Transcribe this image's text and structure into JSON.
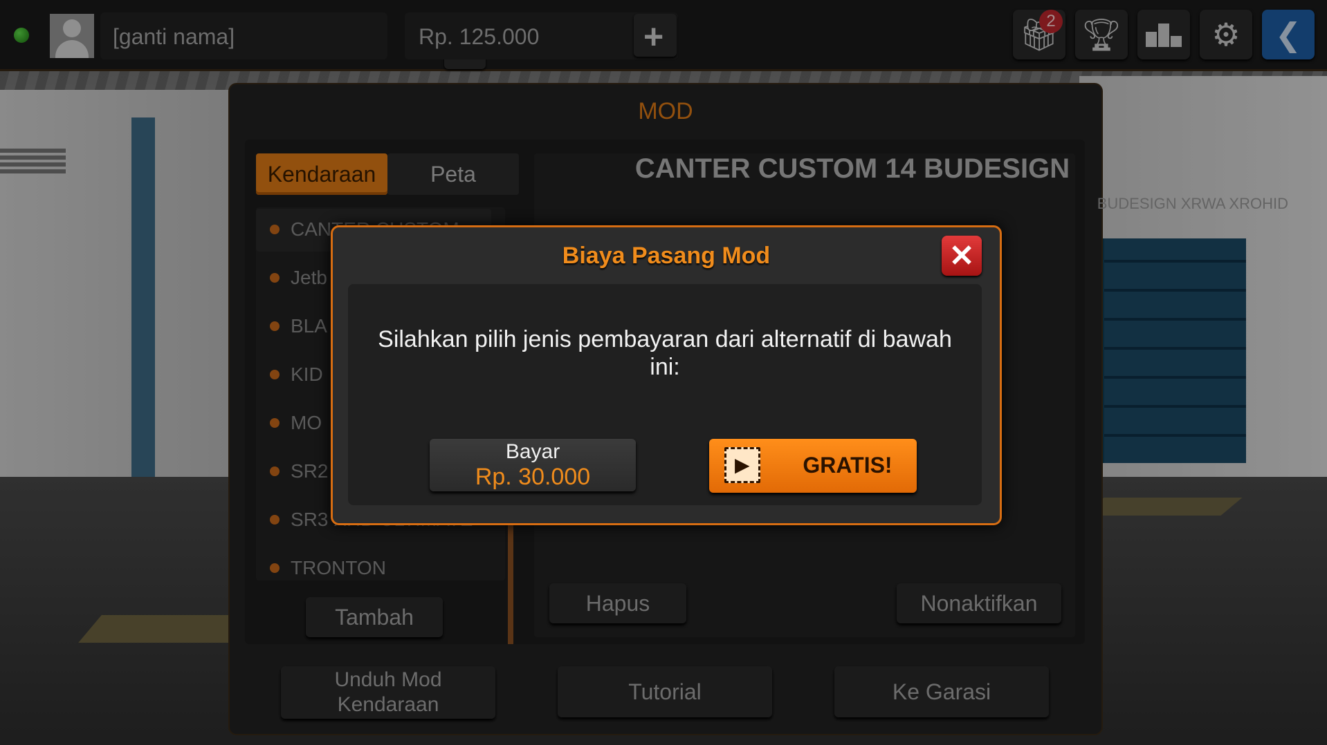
{
  "topbar": {
    "player_name": "[ganti nama]",
    "money": "Rp. 125.000",
    "gift_badge": "2",
    "icons": [
      "gift-icon",
      "trophy-icon",
      "leaderboard-icon",
      "settings-icon",
      "back-icon"
    ]
  },
  "mod_panel": {
    "title": "MOD",
    "tabs": [
      "Kendaraan",
      "Peta"
    ],
    "active_tab": "Kendaraan",
    "list_items": [
      "CANTER CUSTOM",
      "Jetb",
      "BLA",
      "KID",
      "MO",
      "SR2",
      "SR3 XHD ULTIMATE",
      "TRONTON"
    ],
    "add_button": "Tambah",
    "detail_title": "CANTER CUSTOM 14 BUDESIGN",
    "detail_subtitle": "BUDESIGN XRWA XROHID",
    "delete_button": "Hapus",
    "disable_button": "Nonaktifkan",
    "download_button_line1": "Unduh Mod",
    "download_button_line2": "Kendaraan",
    "tutorial_button": "Tutorial",
    "garage_button": "Ke Garasi"
  },
  "dialog": {
    "title": "Biaya Pasang Mod",
    "close_label": "✕",
    "message": "Silahkan pilih jenis pembayaran dari alternatif di bawah ini:",
    "pay_label": "Bayar",
    "pay_price": "Rp. 30.000",
    "free_label": "GRATIS!"
  },
  "colors": {
    "accent": "#e07b16",
    "close": "#c81e1e",
    "status": "#3fbf2a"
  }
}
